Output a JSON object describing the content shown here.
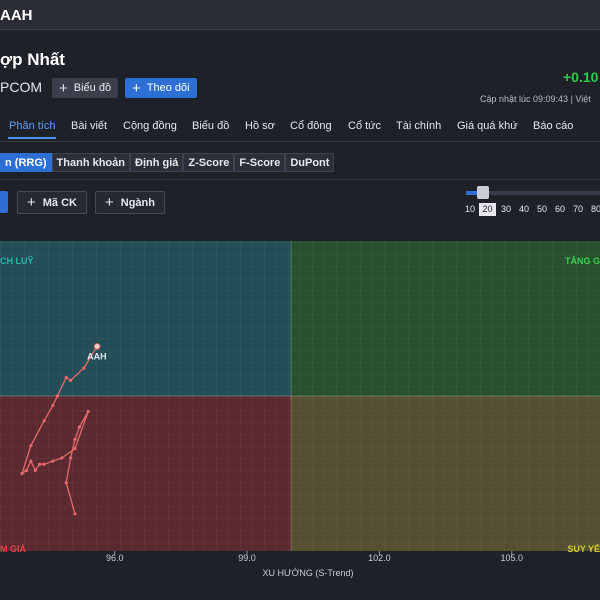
{
  "header": {
    "ticker": "AAH"
  },
  "company": {
    "name": "ợp Nhất",
    "exchange": "PCOM"
  },
  "actions": {
    "chart_label": "Biểu đồ",
    "follow_label": "Theo dõi"
  },
  "price": {
    "change": "+0.10",
    "updated": "Cập nhật lúc  09:09:43 | Việt"
  },
  "tabs": [
    "Phân tích",
    "Bài viết",
    "Cộng đồng",
    "Biểu đồ",
    "Hồ sơ",
    "Cổ đông",
    "Cổ tức",
    "Tài chính",
    "Giá quá khứ",
    "Báo cáo"
  ],
  "subtabs": [
    "n (RRG)",
    "Thanh khoản",
    "Định giá",
    "Z-Score",
    "F-Score",
    "DuPont"
  ],
  "filters": {
    "stock_label": "Mã CK",
    "sector_label": "Ngành"
  },
  "slider": {
    "ticks": [
      "10",
      "20",
      "30",
      "40",
      "50",
      "60",
      "70",
      "80",
      "9"
    ],
    "selected": "20",
    "value_fraction": 0.13
  },
  "colors": {
    "accent": "#2e6fd6",
    "positive": "#2ecc4e",
    "q_tl": "#234e57",
    "q_tr": "#28512f",
    "q_bl": "#5a2a30",
    "q_br": "#545031",
    "trail": "#e46a6a"
  },
  "chart_data": {
    "type": "scatter",
    "xlabel": "XU HƯỚNG (S-Trend)",
    "ylabel": "",
    "x_ticks": [
      "96.0",
      "99.0",
      "102.0",
      "105.0"
    ],
    "xlim": [
      93.4,
      107.0
    ],
    "ylim": [
      95.0,
      105.0
    ],
    "center": [
      100.0,
      100.0
    ],
    "quadrants": {
      "top_left": "CH LUỸ",
      "top_right": "TĂNG G",
      "bottom_left": "M GIÁ",
      "bottom_right": "SUY YẾ"
    },
    "series": [
      {
        "name": "AAH",
        "points": [
          [
            95.1,
            96.2
          ],
          [
            94.9,
            97.2
          ],
          [
            95.0,
            98.0
          ],
          [
            95.1,
            98.6
          ],
          [
            95.2,
            99.0
          ],
          [
            95.4,
            99.5
          ],
          [
            95.1,
            98.3
          ],
          [
            94.8,
            98.0
          ],
          [
            94.6,
            97.9
          ],
          [
            94.4,
            97.8
          ],
          [
            94.3,
            97.8
          ],
          [
            94.2,
            97.6
          ],
          [
            94.1,
            97.9
          ],
          [
            94.0,
            97.6
          ],
          [
            93.9,
            97.5
          ],
          [
            94.1,
            98.4
          ],
          [
            94.4,
            99.2
          ],
          [
            94.6,
            99.7
          ],
          [
            94.7,
            100.0
          ],
          [
            94.9,
            100.6
          ],
          [
            95.0,
            100.5
          ],
          [
            95.3,
            100.9
          ],
          [
            95.6,
            101.6
          ]
        ]
      }
    ]
  }
}
